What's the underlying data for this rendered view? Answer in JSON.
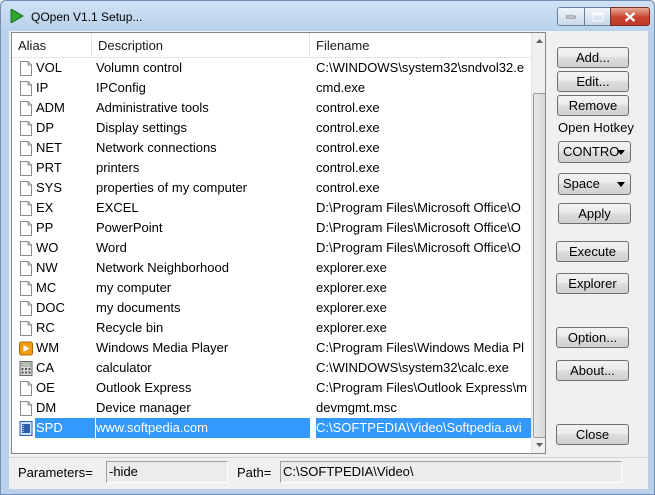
{
  "window": {
    "title": "QOpen V1.1 Setup..."
  },
  "columns": {
    "alias": "Alias",
    "description": "Description",
    "filename": "Filename"
  },
  "rows": [
    {
      "alias": "VOL",
      "description": "Volumn control",
      "filename": "C:\\WINDOWS\\system32\\sndvol32.e",
      "icon": "file-icon"
    },
    {
      "alias": "IP",
      "description": "IPConfig",
      "filename": "cmd.exe",
      "icon": "file-icon"
    },
    {
      "alias": "ADM",
      "description": "Administrative tools",
      "filename": "control.exe",
      "icon": "file-icon"
    },
    {
      "alias": "DP",
      "description": "Display settings",
      "filename": "control.exe",
      "icon": "file-icon"
    },
    {
      "alias": "NET",
      "description": "Network connections",
      "filename": "control.exe",
      "icon": "file-icon"
    },
    {
      "alias": "PRT",
      "description": "printers",
      "filename": "control.exe",
      "icon": "file-icon"
    },
    {
      "alias": "SYS",
      "description": "properties of my computer",
      "filename": "control.exe",
      "icon": "file-icon"
    },
    {
      "alias": "EX",
      "description": "EXCEL",
      "filename": "D:\\Program Files\\Microsoft Office\\O",
      "icon": "file-icon"
    },
    {
      "alias": "PP",
      "description": "PowerPoint",
      "filename": "D:\\Program Files\\Microsoft Office\\O",
      "icon": "file-icon"
    },
    {
      "alias": "WO",
      "description": "Word",
      "filename": "D:\\Program Files\\Microsoft Office\\O",
      "icon": "file-icon"
    },
    {
      "alias": "NW",
      "description": "Network Neighborhood",
      "filename": "explorer.exe",
      "icon": "file-icon"
    },
    {
      "alias": "MC",
      "description": "my computer",
      "filename": "explorer.exe",
      "icon": "file-icon"
    },
    {
      "alias": "DOC",
      "description": "my documents",
      "filename": "explorer.exe",
      "icon": "file-icon"
    },
    {
      "alias": "RC",
      "description": "Recycle bin",
      "filename": "explorer.exe",
      "icon": "file-icon"
    },
    {
      "alias": "WM",
      "description": "Windows Media Player",
      "filename": "C:\\Program Files\\Windows Media Pl",
      "icon": "media-player-icon"
    },
    {
      "alias": "CA",
      "description": "calculator",
      "filename": "C:\\WINDOWS\\system32\\calc.exe",
      "icon": "calculator-icon"
    },
    {
      "alias": "OE",
      "description": "Outlook Express",
      "filename": "C:\\Program Files\\Outlook Express\\m",
      "icon": "file-icon"
    },
    {
      "alias": "DM",
      "description": "Device manager",
      "filename": "devmgmt.msc",
      "icon": "file-icon"
    },
    {
      "alias": "SPD",
      "description": "www.softpedia.com",
      "filename": "C:\\SOFTPEDIA\\Video\\Softpedia.avi",
      "icon": "video-file-icon",
      "selected": true
    }
  ],
  "buttons": {
    "add": "Add...",
    "edit": "Edit...",
    "remove": "Remove",
    "apply": "Apply",
    "execute": "Execute",
    "explorer": "Explorer",
    "option": "Option...",
    "about": "About...",
    "close": "Close"
  },
  "hotkey": {
    "label": "Open Hotkey",
    "modifier": "CONTRO",
    "key": "Space"
  },
  "status": {
    "parameters_label": "Parameters=",
    "parameters_value": "-hide",
    "path_label": "Path=",
    "path_value": "C:\\SOFTPEDIA\\Video\\"
  },
  "colors": {
    "selection": "#3399ff",
    "title_gradient": "#b9d1ea",
    "close_button": "#c7452e"
  }
}
